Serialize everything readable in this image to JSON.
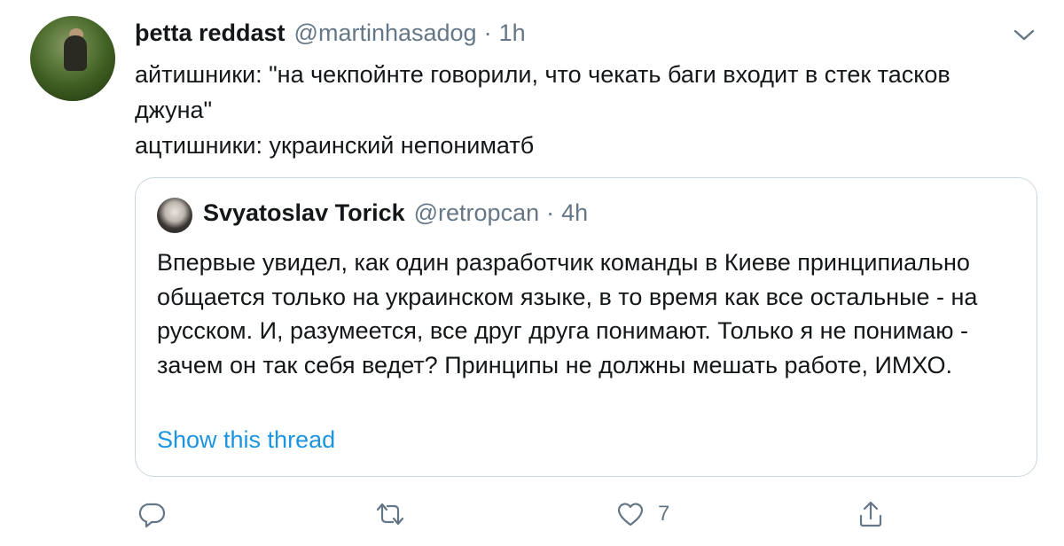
{
  "tweet": {
    "author_name": "þetta reddast",
    "author_handle": "@martinhasadog",
    "separator": "·",
    "time": "1h",
    "text_lines": [
      "айтишники: \"на чекпойнте говорили, что чекать баги входит в стек тасков джуна\"",
      "ацтишники: украинский непониматб"
    ]
  },
  "quoted": {
    "author_name": "Svyatoslav Torick",
    "author_handle": "@retropcan",
    "separator": "·",
    "time": "4h",
    "text": "Впервые увидел, как один разработчик команды в Киеве принципиально общается только на украинском языке, в то время как все остальные - на русском. И, разумеется, все друг друга понимают. Только я не понимаю - зачем он так себя ведет? Принципы не должны мешать работе, ИМХО.",
    "show_thread": "Show this thread"
  },
  "actions": {
    "reply_icon": "reply-icon",
    "retweet_icon": "retweet-icon",
    "like_icon": "heart-icon",
    "like_count": "7",
    "share_icon": "share-icon"
  },
  "colors": {
    "text": "#14171a",
    "secondary": "#657786",
    "link": "#1b95e0",
    "border": "#ccd6dd"
  }
}
